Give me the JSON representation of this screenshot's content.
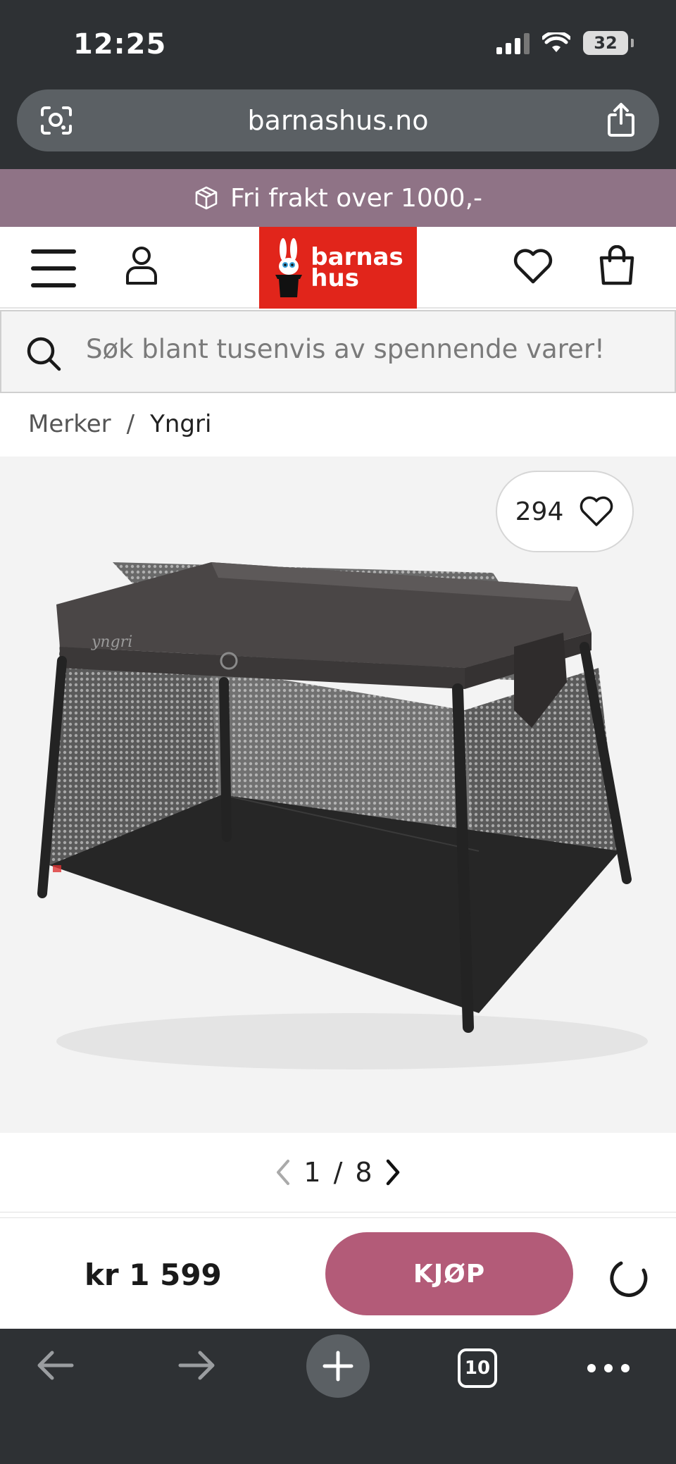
{
  "status": {
    "time": "12:25",
    "battery": "32"
  },
  "browser": {
    "url": "barnashus.no"
  },
  "promo": {
    "text": "Fri frakt over 1000,-",
    "bg": "#8f7386"
  },
  "header": {
    "logo_line1": "barnas",
    "logo_line2": "hus",
    "logo_color": "#e1251b"
  },
  "search": {
    "placeholder": "Søk blant tusenvis av spennende varer!"
  },
  "breadcrumb": {
    "items": [
      "Merker",
      "Yngri"
    ],
    "separator": "/"
  },
  "product": {
    "favorites_count": "294",
    "image_brand_mark": "yngri",
    "image_index": "1",
    "image_total": "8",
    "page_separator": "/",
    "price": "kr 1 599",
    "buy_label": "KJØP",
    "buy_color": "#b35b78"
  },
  "toolbar": {
    "tab_count": "10"
  }
}
